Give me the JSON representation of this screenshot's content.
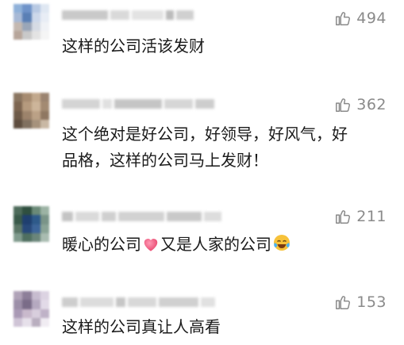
{
  "comments": [
    {
      "text": "这样的公司活该发财",
      "likes": "494",
      "avatar_colors": [
        "#8fb1d9",
        "#6f93c9",
        "#b8c9e3",
        "#dfe7f2",
        "#a7b9d6",
        "#5a7fb5",
        "#cdd8ea",
        "#e8edf5",
        "#c4b8b0",
        "#9aa6b8",
        "#d6dbe4",
        "#f0f2f6",
        "#b7a59a",
        "#c9c9c9",
        "#e3e3e3",
        "#f5f5f5"
      ]
    },
    {
      "text_line1": "这个绝对是好公司，好领导，好风气，好",
      "text_line2": "品格，这样的公司马上发财！",
      "likes": "362",
      "avatar_colors": [
        "#8a7560",
        "#a68b70",
        "#c2a88c",
        "#9b8470",
        "#7d6550",
        "#b59a7e",
        "#cdb59a",
        "#a38a72",
        "#6e5a48",
        "#9c836b",
        "#bba186",
        "#8f7762",
        "#5e4d3e",
        "#80705f",
        "#a6927c",
        "#c9b8a4"
      ]
    },
    {
      "text": "暖心的公司",
      "text_after_heart": "又是人家的公司",
      "likes": "211",
      "emoji": [
        "heart-icon",
        "laughing-tears-icon"
      ],
      "avatar_colors": [
        "#4d6b5a",
        "#2f4f3f",
        "#6b8a78",
        "#9cb3a4",
        "#3a5a4a",
        "#1f3f6f",
        "#2e5a8a",
        "#7a9488",
        "#5a7565",
        "#28497a",
        "#3d6599",
        "#8aa396",
        "#7f9a8c",
        "#4f6f60",
        "#6a857a",
        "#a9bcb1"
      ]
    },
    {
      "text": "这样的公司真让人高看",
      "likes": "153",
      "avatar_colors": [
        "#b0a3b8",
        "#8d7f99",
        "#c7bccf",
        "#dcd3e2",
        "#9c8fa8",
        "#7a6c88",
        "#b5a9c0",
        "#e2dae8",
        "#a999b5",
        "#c9b9cc",
        "#d8cedd",
        "#bfb2c7",
        "#cfc4d6",
        "#e6e0ea",
        "#b9aebf",
        "#f0ecf2"
      ]
    }
  ],
  "colors": {
    "text": "#1a1a1a",
    "like_count": "#8a8a8a",
    "heart": "#f05a7e",
    "emoji_face": "#f7c23a"
  }
}
